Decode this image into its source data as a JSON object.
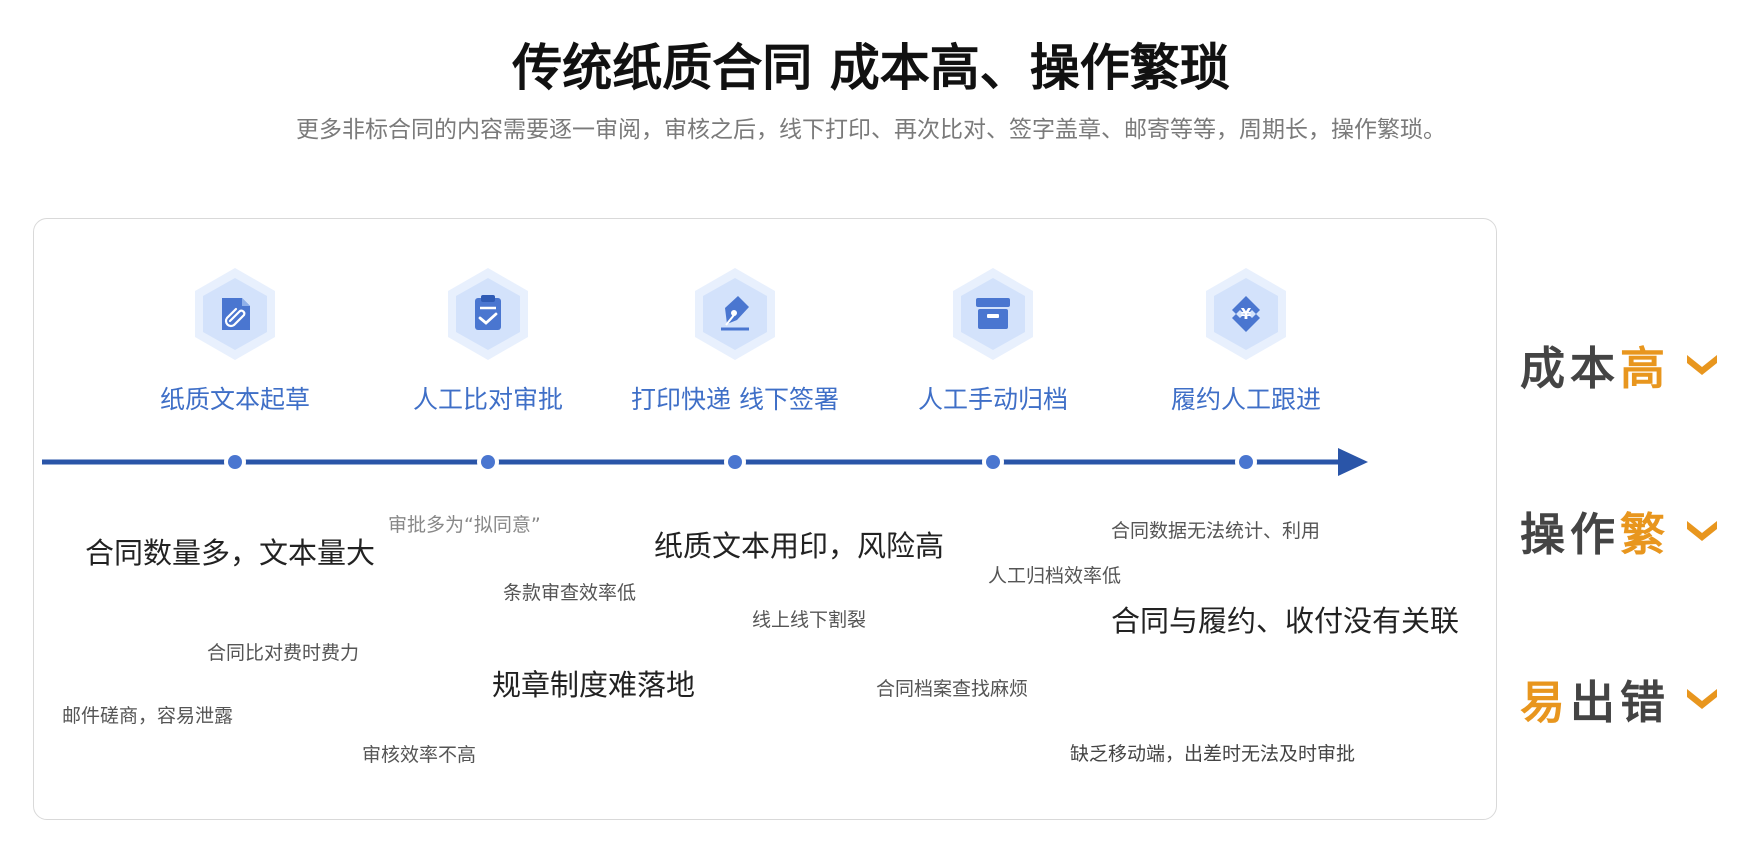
{
  "header": {
    "title": "传统纸质合同 成本高、操作繁琐",
    "subtitle": "更多非标合同的内容需要逐一审阅，审核之后，线下打印、再次比对、签字盖章、邮寄等等，周期长，操作繁琐。"
  },
  "steps": [
    {
      "label": "纸质文本起草",
      "icon": "paperclip-document-icon"
    },
    {
      "label": "人工比对审批",
      "icon": "clipboard-check-icon"
    },
    {
      "label": "打印快递 线下签署",
      "icon": "pen-sign-icon"
    },
    {
      "label": "人工手动归档",
      "icon": "archive-box-icon"
    },
    {
      "label": "履约人工跟进",
      "icon": "yuan-exchange-icon"
    }
  ],
  "issues": [
    "合同数量多，文本量大",
    "审批多为“拟同意”",
    "条款审查效率低",
    "合同比对费时费力",
    "规章制度难落地",
    "邮件磋商，容易泄露",
    "审核效率不高",
    "纸质文本用印，风险高",
    "线上线下割裂",
    "合同档案查找麻烦",
    "人工归档效率低",
    "合同数据无法统计、利用",
    "合同与履约、收付没有关联",
    "缺乏移动端，出差时无法及时审批"
  ],
  "side": [
    {
      "main": "成本",
      "accent": "高"
    },
    {
      "main": "操作",
      "accent": "繁"
    },
    {
      "main": "出错",
      "accent": "易"
    }
  ],
  "colors": {
    "timeline": "#2a55a8",
    "step_text": "#3f6fc7",
    "accent": "#e8961e",
    "hexagon_light": "#dce8fb",
    "icon_fill": "#4a76d0"
  }
}
